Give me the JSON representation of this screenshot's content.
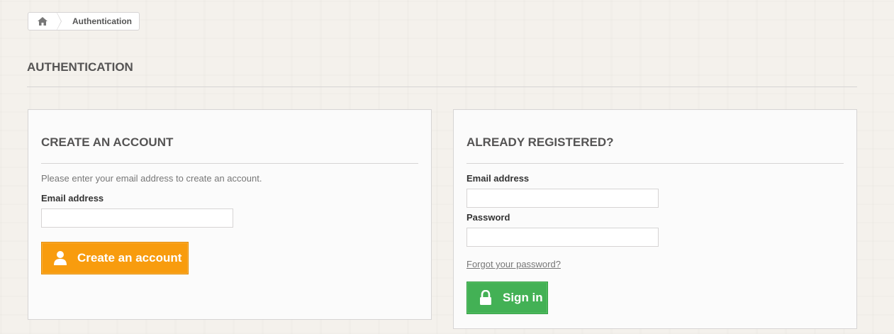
{
  "breadcrumb": {
    "home_icon": "home-icon",
    "current": "Authentication"
  },
  "page": {
    "heading": "Authentication"
  },
  "create_account": {
    "title": "CREATE AN ACCOUNT",
    "help_text": "Please enter your email address to create an account.",
    "email_label": "Email address",
    "email_value": "",
    "button_label": "Create an account",
    "button_icon": "user-icon",
    "button_color": "#f89c0e"
  },
  "login": {
    "title": "ALREADY REGISTERED?",
    "email_label": "Email address",
    "email_value": "",
    "password_label": "Password",
    "password_value": "",
    "forgot_link": "Forgot your password?",
    "button_label": "Sign in",
    "button_icon": "lock-icon",
    "button_color": "#43b155"
  }
}
